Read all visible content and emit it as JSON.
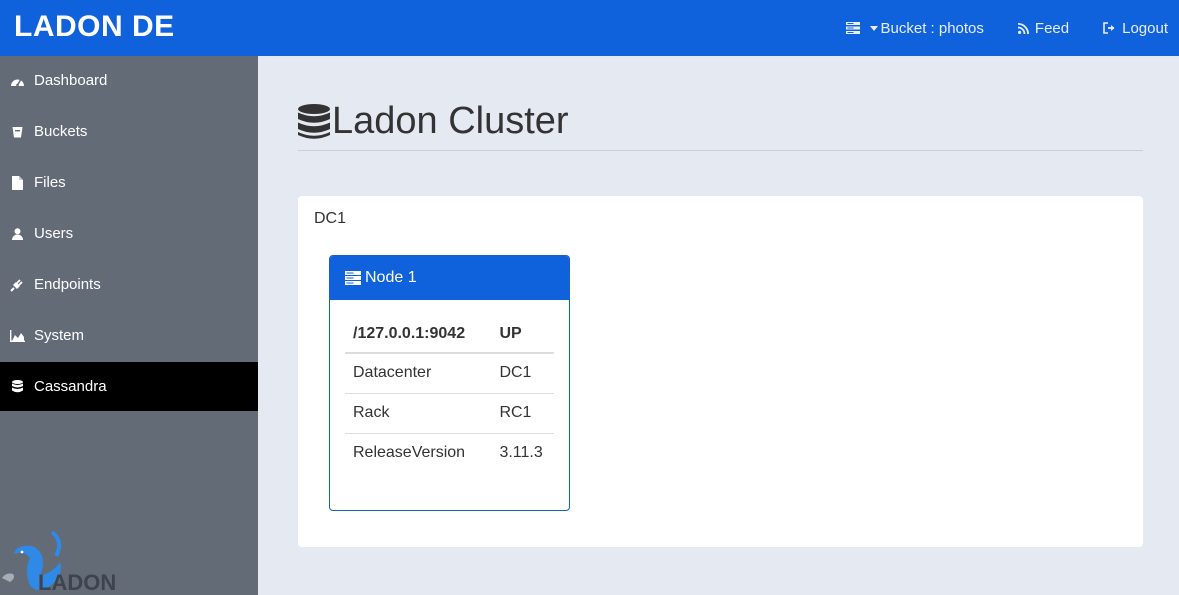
{
  "header": {
    "brand": "LADON DE",
    "bucket_label": "Bucket : photos",
    "feed_label": "Feed",
    "logout_label": "Logout"
  },
  "sidebar": {
    "items": [
      {
        "label": "Dashboard",
        "icon": "dashboard-icon"
      },
      {
        "label": "Buckets",
        "icon": "bucket-icon"
      },
      {
        "label": "Files",
        "icon": "file-icon"
      },
      {
        "label": "Users",
        "icon": "user-icon"
      },
      {
        "label": "Endpoints",
        "icon": "plug-icon"
      },
      {
        "label": "System",
        "icon": "area-chart-icon"
      },
      {
        "label": "Cassandra",
        "icon": "database-icon",
        "active": true
      }
    ],
    "logo_text": "LADON"
  },
  "main": {
    "title": "Ladon Cluster",
    "datacenter": {
      "name": "DC1",
      "nodes": [
        {
          "title": "Node 1",
          "address": "/127.0.0.1:9042",
          "status": "UP",
          "rows": [
            {
              "key": "Datacenter",
              "value": "DC1"
            },
            {
              "key": "Rack",
              "value": "RC1"
            },
            {
              "key": "ReleaseVersion",
              "value": "3.11.3"
            }
          ]
        }
      ]
    }
  },
  "colors": {
    "primary": "#0f61dc",
    "sidebar": "#636b77",
    "sidebar_active": "#000000",
    "background": "#e5eaf2"
  }
}
